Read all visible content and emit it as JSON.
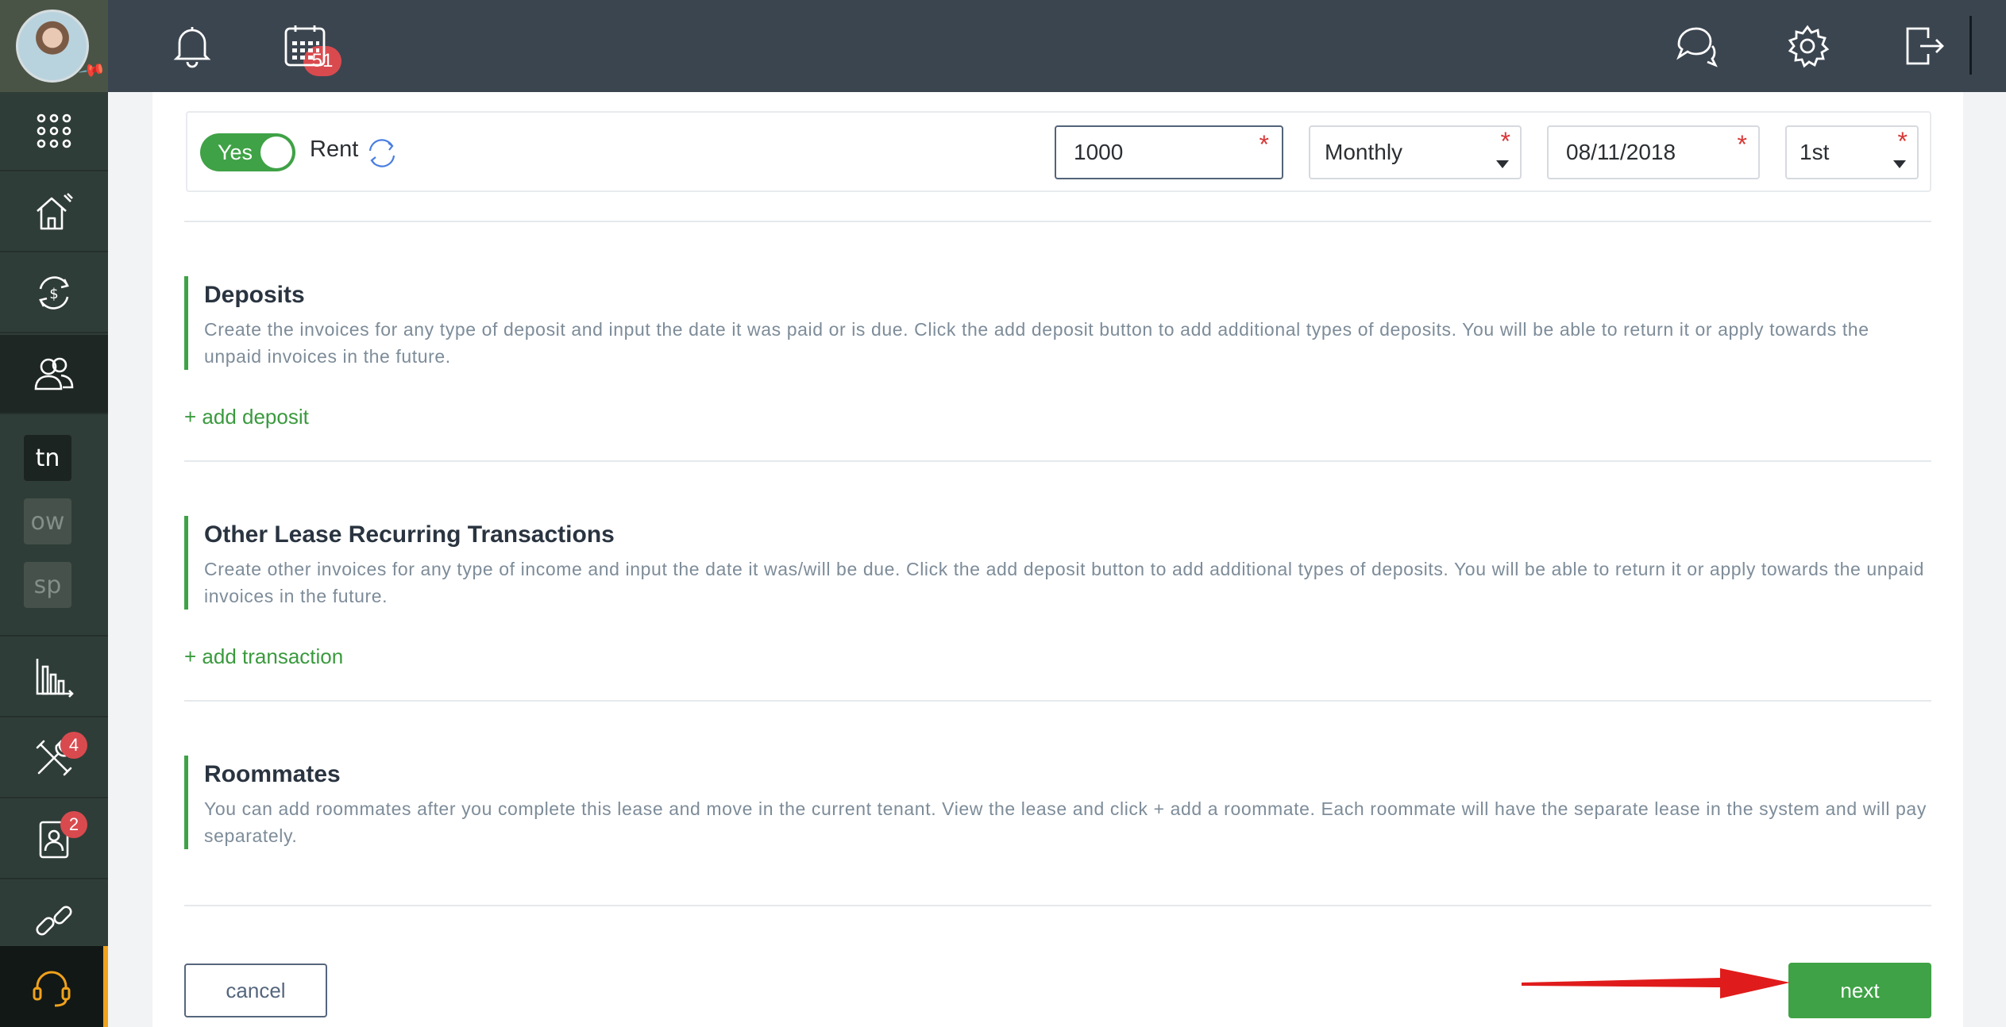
{
  "topbar": {
    "notifications_count": "51"
  },
  "sidebar": {
    "abbr": [
      "tn",
      "ow",
      "sp"
    ],
    "maintenance_badge": "4",
    "applications_badge": "2"
  },
  "rent": {
    "toggle_label": "Yes",
    "label": "Rent",
    "amount": "1000",
    "frequency": "Monthly",
    "start_date": "08/11/2018",
    "due_day": "1st",
    "required_mark": "*"
  },
  "deposits": {
    "title": "Deposits",
    "description": "Create the invoices for any type of deposit and input the date it was paid or is due. Click the add deposit button to add additional types of deposits. You will be able to return it or apply towards the unpaid invoices in the future.",
    "add_label": "+ add deposit"
  },
  "other_transactions": {
    "title": "Other Lease Recurring Transactions",
    "description": "Create other invoices for any type of income and input the date it was/will be due. Click the add deposit button to add additional types of deposits. You will be able to return it or apply towards the unpaid invoices in the future.",
    "add_label": "+ add transaction"
  },
  "roommates": {
    "title": "Roommates",
    "description": "You can add roommates after you complete this lease and move in the current tenant. View the lease and click + add a roommate. Each roommate will have the separate lease in the system and will pay separately."
  },
  "actions": {
    "cancel_label": "cancel",
    "next_label": "next"
  },
  "colors": {
    "accent_green": "#3fa246",
    "topbar": "#3b4550",
    "sidebar": "#2f3d38",
    "badge_red": "#d94a4f",
    "support_accent": "#f0a21b"
  }
}
